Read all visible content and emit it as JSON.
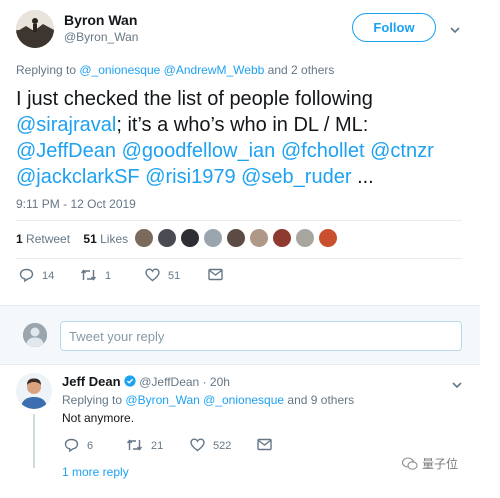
{
  "tweet": {
    "author_name": "Byron Wan",
    "author_handle": "@Byron_Wan",
    "follow_label": "Follow",
    "replying_prefix": "Replying to",
    "replying_users": "@_onionesque @AndrewM_Webb",
    "replying_suffix": "and 2 others",
    "text_plain_1": "I just checked the list of people following",
    "mention_siraj": "@sirajraval",
    "text_plain_2": "; it’s a who’s who in DL / ML:",
    "mention_jeffdean": "@JeffDean",
    "mention_goodfellow": "@goodfellow_ian",
    "mention_fchollet": "@fchollet",
    "mention_ctnzr": "@ctnzr",
    "mention_jackclark": "@jackclarkSF",
    "mention_risi": "@risi1979",
    "mention_seb": "@seb_ruder",
    "ellipsis": "...",
    "timestamp": "9:11 PM - 12 Oct 2019",
    "retweets_count": "1",
    "retweets_label": "Retweet",
    "likes_count": "51",
    "likes_label": "Likes",
    "reply_count": "14",
    "retweet_count_action": "1",
    "like_count_action": "51"
  },
  "composer": {
    "placeholder": "Tweet your reply"
  },
  "reply": {
    "author_name": "Jeff Dean",
    "author_handle": "@JeffDean",
    "separator": "·",
    "age": "20h",
    "replying_prefix": "Replying to",
    "replying_users": "@Byron_Wan @_onionesque",
    "replying_suffix": "and 9 others",
    "text": "Not anymore.",
    "reply_count": "6",
    "retweet_count": "21",
    "like_count": "522",
    "more_replies": "1 more reply"
  },
  "watermark": {
    "text": "量子位"
  },
  "colors": {
    "accent": "#1da1f2",
    "muted": "#657786",
    "border": "#e6ecf0",
    "verified": "#1da1f2"
  },
  "icons": {
    "reply": "reply-icon",
    "retweet": "retweet-icon",
    "like": "heart-icon",
    "dm": "envelope-icon",
    "more": "chevron-down-icon",
    "verified": "verified-badge-icon"
  }
}
